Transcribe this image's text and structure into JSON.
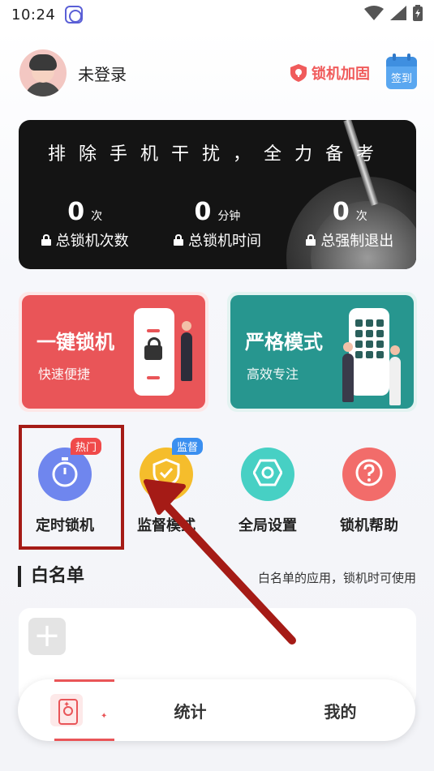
{
  "status": {
    "time": "10:24"
  },
  "header": {
    "login_text": "未登录",
    "reinforce_label": "锁机加固",
    "checkin_label": "签到"
  },
  "banner": {
    "slogan": "排除手机干扰，全力备考",
    "stats": [
      {
        "value": "0",
        "unit": "次",
        "label": "总锁机次数"
      },
      {
        "value": "0",
        "unit": "分钟",
        "label": "总锁机时间"
      },
      {
        "value": "0",
        "unit": "次",
        "label": "总强制退出"
      }
    ]
  },
  "cards": {
    "onekey": {
      "title": "一键锁机",
      "subtitle": "快速便捷"
    },
    "strict": {
      "title": "严格模式",
      "subtitle": "高效专注"
    }
  },
  "features": [
    {
      "label": "定时锁机",
      "badge": "热门",
      "icon": "stopwatch-icon"
    },
    {
      "label": "监督模式",
      "badge": "监督",
      "icon": "shield-check-icon"
    },
    {
      "label": "全局设置",
      "badge": "",
      "icon": "hex-settings-icon"
    },
    {
      "label": "锁机帮助",
      "badge": "",
      "icon": "question-icon"
    }
  ],
  "whitelist": {
    "title": "白名单",
    "description": "白名单的应用，锁机时可使用"
  },
  "tabbar": {
    "tabs": [
      {
        "label": ""
      },
      {
        "label": "统计"
      },
      {
        "label": "我的"
      }
    ]
  },
  "colors": {
    "accent_red": "#e95558",
    "strict_teal": "#27968f",
    "highlight_box": "#a51b16"
  }
}
